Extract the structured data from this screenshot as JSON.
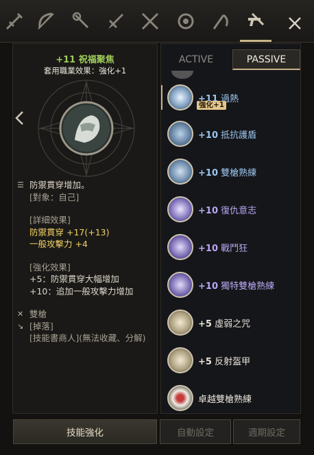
{
  "weapon_tabs": [
    {
      "icon": "crossbow-icon"
    },
    {
      "icon": "bow-icon"
    },
    {
      "icon": "staff-icon"
    },
    {
      "icon": "greatsword-icon"
    },
    {
      "icon": "dual-swords-icon"
    },
    {
      "icon": "orb-icon"
    },
    {
      "icon": "scythe-icon"
    },
    {
      "icon": "dual-pistols-icon"
    }
  ],
  "close_icon": "close-icon",
  "left": {
    "skill_title": "+11 祝福聚焦",
    "skill_subtitle": "套用職業效果：強化+1",
    "desc_line1": "防禦貫穿增加。",
    "target": "[對象：自己]",
    "detail_header": "[詳細效果]",
    "detail_line1": "防禦貫穿 +17(+13)",
    "detail_line2": "一般攻擊力 +4",
    "enhance_header": "[強化效果]",
    "enhance_line1": "+5：防禦貫穿大幅增加",
    "enhance_line2": "+10：追加一般攻擊力增加",
    "weapon_label": "雙槍",
    "drop_header": "[掉落]",
    "drop_line": "[技能書商人](無法收藏、分解)"
  },
  "buttons": {
    "enhance": "技能強化",
    "auto": "自動設定",
    "cycle": "週期設定"
  },
  "tabs": {
    "active": "ACTIVE",
    "passive": "PASSIVE"
  },
  "skills": [
    {
      "level": "+11",
      "name": "過熱",
      "badge": "強化+1",
      "color": "blue"
    },
    {
      "level": "+10",
      "name": "抵抗護盾",
      "color": "blue"
    },
    {
      "level": "+10",
      "name": "雙槍熟練",
      "color": "blue"
    },
    {
      "level": "+10",
      "name": "復仇意志",
      "color": "purple"
    },
    {
      "level": "+10",
      "name": "戰鬥狂",
      "color": "purple"
    },
    {
      "level": "+10",
      "name": "獨特雙槍熟練",
      "color": "purple"
    },
    {
      "level": "+5",
      "name": "虛弱之咒",
      "color": "plain"
    },
    {
      "level": "+5",
      "name": "反射盔甲",
      "color": "plain"
    },
    {
      "level": "",
      "name": "卓越雙槍熟練",
      "color": "plain"
    }
  ],
  "colors": {
    "accent": "#c9b48a",
    "green_title": "#9fcc5a",
    "gold_value": "#f3d264",
    "blue_skill": "#9cc6ee",
    "purple_skill": "#b9a7f2"
  }
}
